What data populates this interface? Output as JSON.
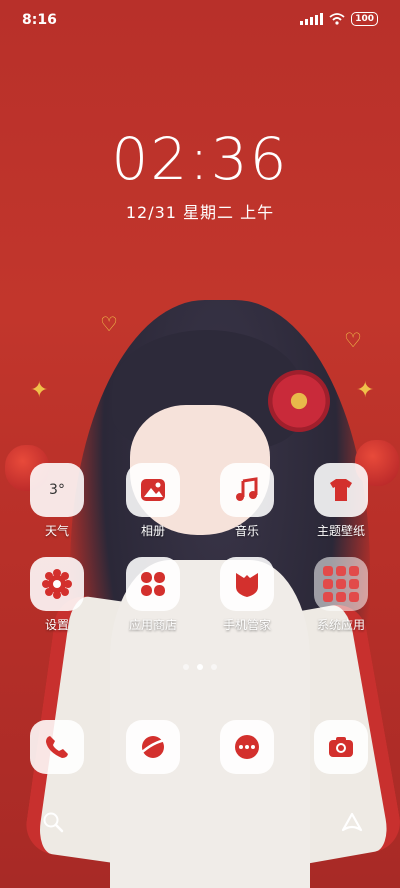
{
  "status_bar": {
    "time": "8:16",
    "battery": "100"
  },
  "lockclock": {
    "time": "02:36",
    "date": "12/31 星期二 上午"
  },
  "apps": [
    {
      "label": "天气",
      "icon": "weather-icon",
      "tile_text": "3°"
    },
    {
      "label": "相册",
      "icon": "gallery-icon"
    },
    {
      "label": "音乐",
      "icon": "music-icon"
    },
    {
      "label": "主题壁纸",
      "icon": "themes-icon"
    },
    {
      "label": "设置",
      "icon": "settings-icon"
    },
    {
      "label": "应用商店",
      "icon": "app-store-icon"
    },
    {
      "label": "手机管家",
      "icon": "security-icon"
    },
    {
      "label": "系统应用",
      "icon": "folder-icon"
    }
  ],
  "dock": [
    {
      "icon": "phone-icon"
    },
    {
      "icon": "browser-icon"
    },
    {
      "icon": "messages-icon"
    },
    {
      "icon": "camera-icon"
    }
  ],
  "bottom_bar": {
    "left": "search-icon",
    "right": "app-drawer-icon"
  },
  "page_indicator": {
    "count": 3,
    "active": 2
  },
  "colors": {
    "accent": "#d3302d",
    "wallpaper": "#b8302a",
    "tile": "#f2eeee"
  }
}
